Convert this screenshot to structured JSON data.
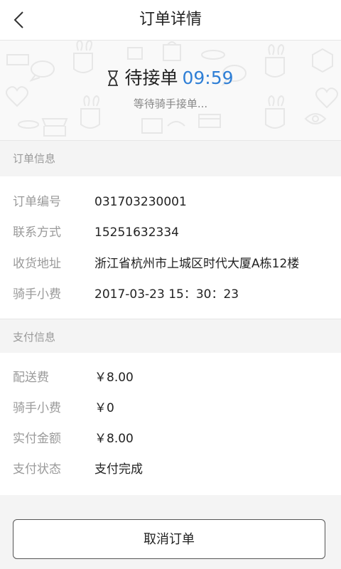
{
  "header": {
    "title": "订单详情",
    "back_icon": "chevron-left-icon"
  },
  "status": {
    "icon": "hourglass-icon",
    "label": "待接单",
    "timer": "09:59",
    "subtitle": "等待骑手接单...",
    "timer_color": "#2f7fd6"
  },
  "order_info": {
    "section_title": "订单信息",
    "rows": [
      {
        "label": "订单编号",
        "value": "031703230001"
      },
      {
        "label": "联系方式",
        "value": "15251632334"
      },
      {
        "label": "收货地址",
        "value": "浙江省杭州市上城区时代大厦A栋12楼"
      },
      {
        "label": "骑手小费",
        "value": "2017-03-23  15：30：23"
      }
    ]
  },
  "payment_info": {
    "section_title": "支付信息",
    "rows": [
      {
        "label": "配送费",
        "value": "￥8.00"
      },
      {
        "label": "骑手小费",
        "value": "￥0"
      },
      {
        "label": "实付金额",
        "value": "￥8.00"
      },
      {
        "label": "支付状态",
        "value": "支付完成"
      }
    ]
  },
  "actions": {
    "cancel_label": "取消订单"
  }
}
